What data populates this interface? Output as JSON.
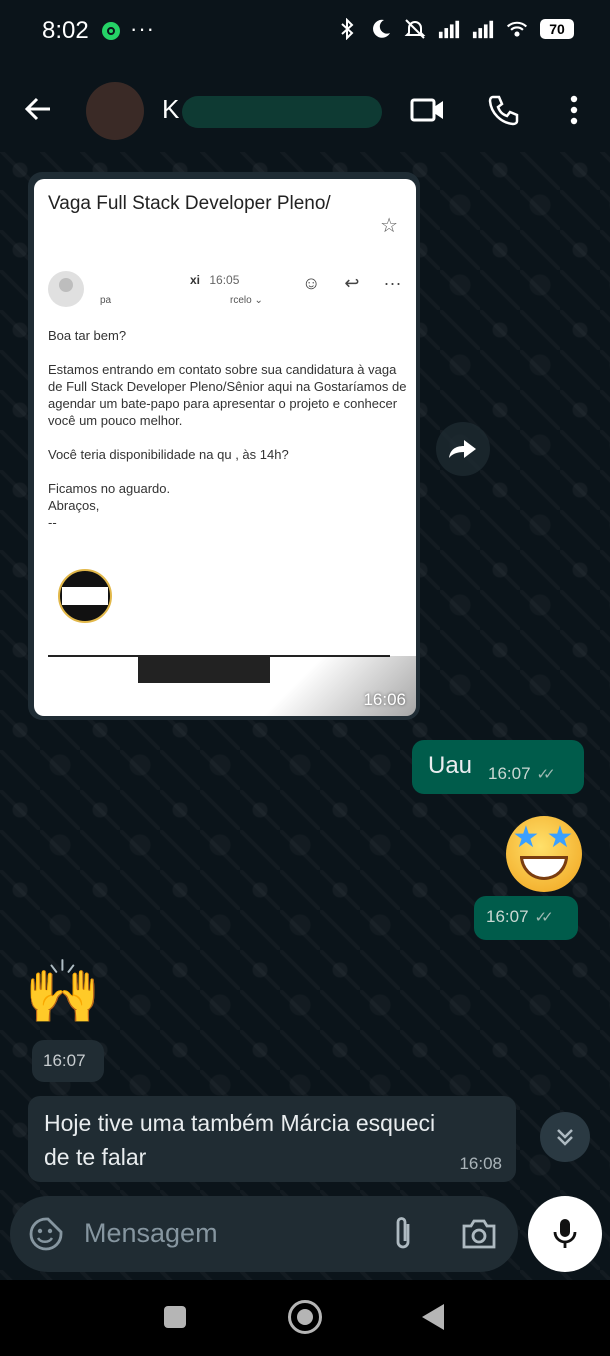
{
  "status_bar": {
    "time": "8:02",
    "dots": "···",
    "battery": "70",
    "icons": [
      "bluetooth-icon",
      "moon-icon",
      "mute-icon",
      "signal-icon",
      "signal-icon",
      "wifi-icon"
    ]
  },
  "header": {
    "contact_name": "K",
    "icons": [
      "back-arrow-icon",
      "video-call-icon",
      "phone-call-icon",
      "more-vert-icon"
    ]
  },
  "messages": {
    "image": {
      "email": {
        "subject": "Vaga Full Stack Developer Pleno/",
        "sender_suffix": "xi",
        "sent_time": "16:05",
        "to_prefix": "pa",
        "to_suffix": "rcelo ⌄",
        "greeting": "Boa tar                           bem?",
        "paragraph1": "Estamos entrando em contato sobre sua candidatura à vaga de Full Stack Developer Pleno/Sênior aqui na              Gostaríamos de agendar um bate-papo para apresentar o projeto e conhecer você um pouco melhor.",
        "paragraph2": "Você teria disponibilidade na qu                 ,               às 14h?",
        "closing1": "Ficamos no aguardo.",
        "closing2": "Abraços,",
        "signature": "--"
      },
      "time": "16:06"
    },
    "uau": {
      "text": "Uau",
      "time": "16:07"
    },
    "emoji_star": {
      "time": "16:07"
    },
    "emoji_hands": {
      "emoji": "🙌",
      "time": "16:07"
    },
    "incoming_text": {
      "text": "Hoje tive uma também Márcia esqueci de te falar",
      "time": "16:08"
    }
  },
  "input": {
    "placeholder": "Mensagem"
  },
  "colors": {
    "background": "#0b141a",
    "outgoing_bubble": "#005c4b",
    "incoming_bubble": "#202c33",
    "input_bar": "#202c33"
  }
}
